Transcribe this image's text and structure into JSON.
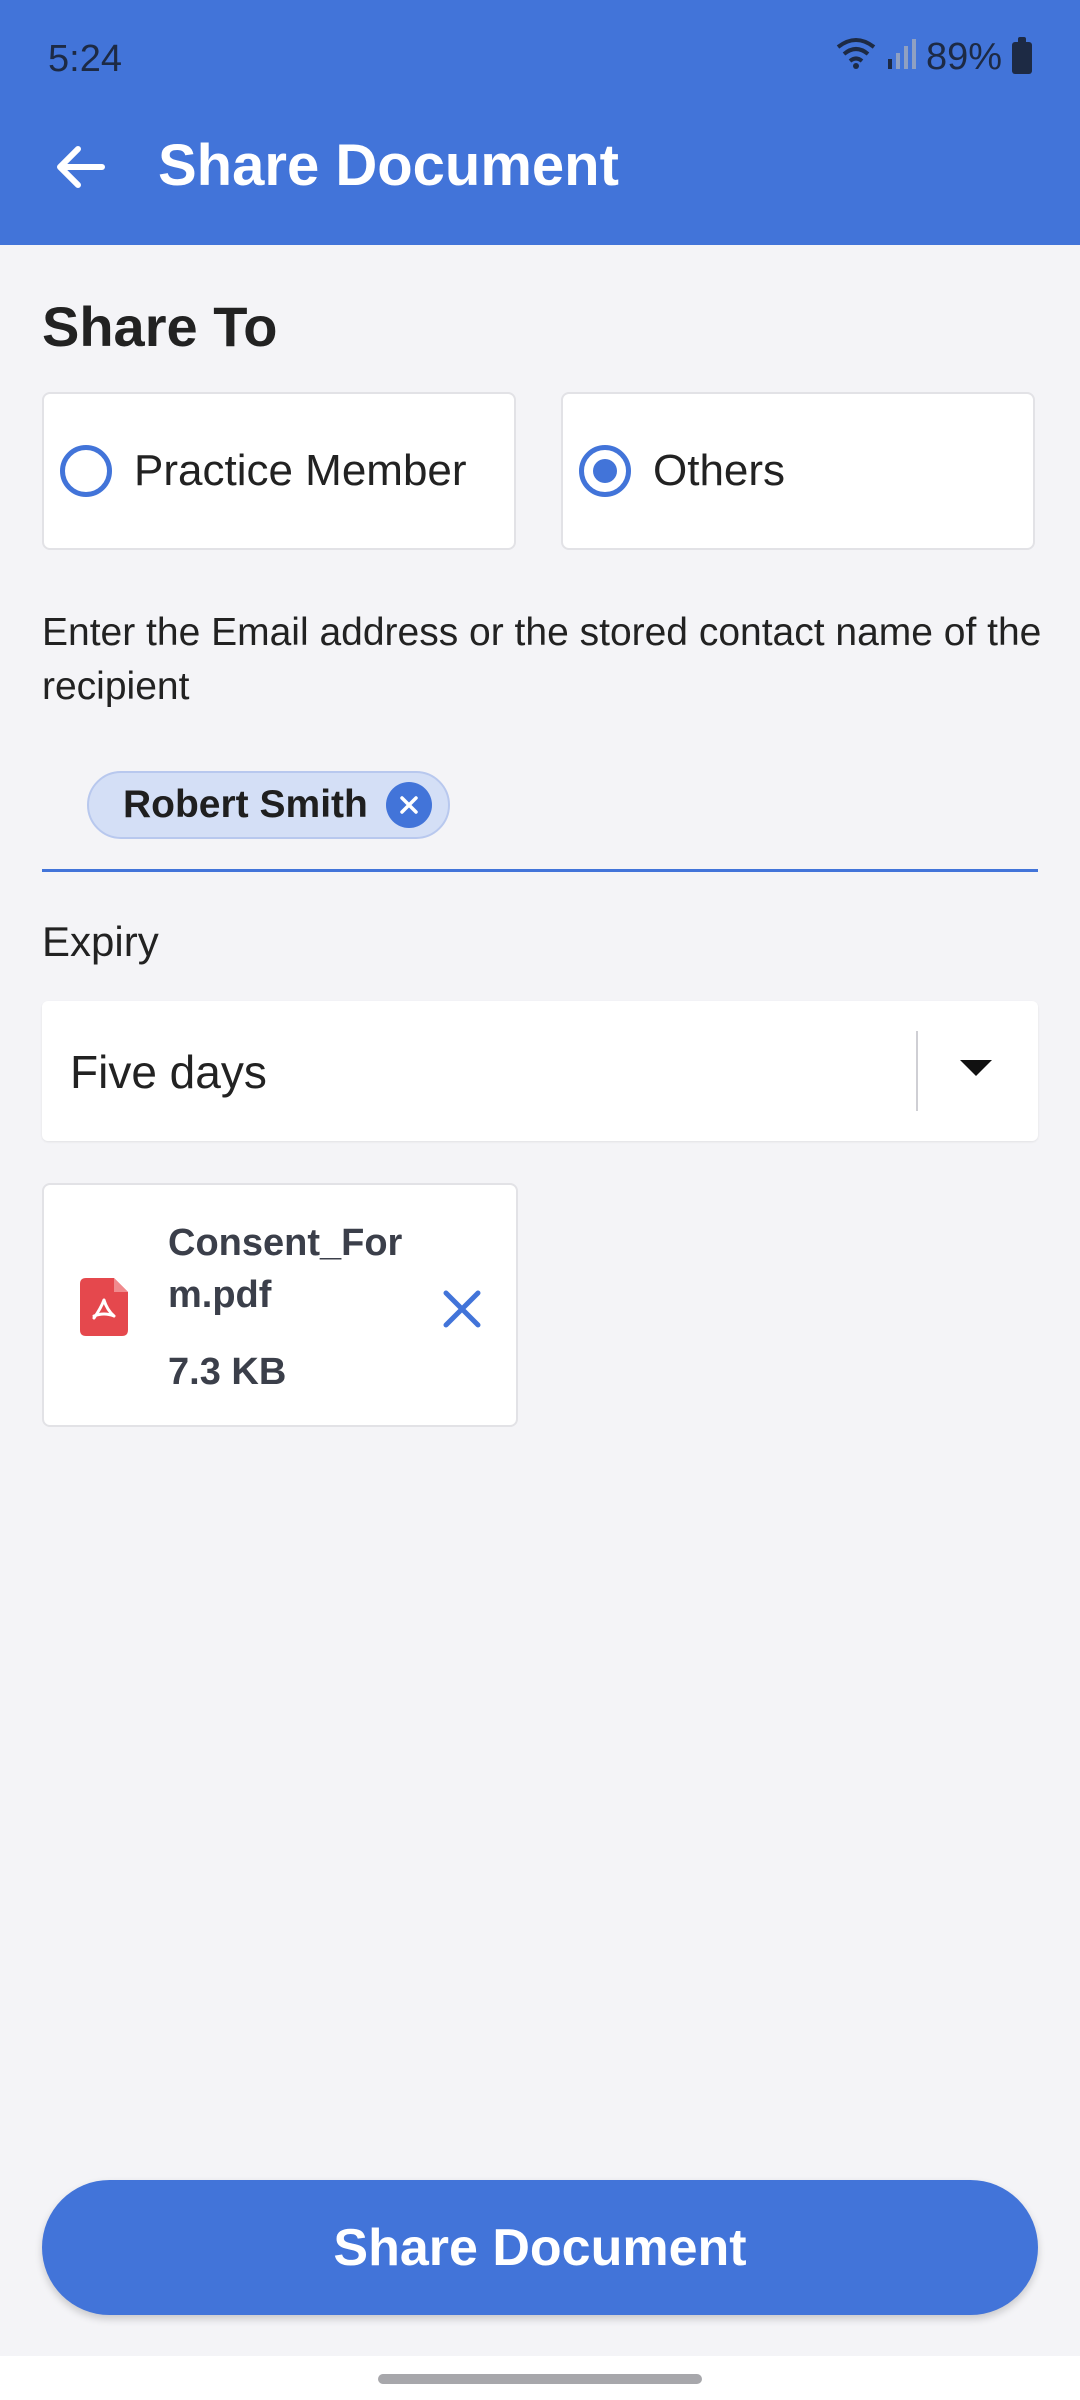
{
  "status_bar": {
    "time": "5:24",
    "battery": "89%"
  },
  "app_bar": {
    "title": "Share Document"
  },
  "share_to": {
    "heading": "Share To",
    "options": [
      {
        "label": "Practice Member",
        "selected": false
      },
      {
        "label": "Others",
        "selected": true
      }
    ]
  },
  "recipient": {
    "instruction": "Enter the Email address or the stored contact name of the recipient",
    "chips": [
      {
        "label": "Robert Smith"
      }
    ]
  },
  "expiry": {
    "label": "Expiry",
    "selected": "Five days"
  },
  "attachment": {
    "name": "Consent_Form.pdf",
    "size": "7.3 KB"
  },
  "primary_button": {
    "label": "Share Document"
  },
  "colors": {
    "primary": "#4274d9",
    "background": "#f4f4f7",
    "chip_bg": "#d4dff6",
    "pdf_red": "#e5484d"
  },
  "icons": [
    "back-arrow-icon",
    "wifi-icon",
    "signal-icon",
    "battery-icon",
    "close-icon",
    "dropdown-caret-icon",
    "pdf-file-icon"
  ]
}
